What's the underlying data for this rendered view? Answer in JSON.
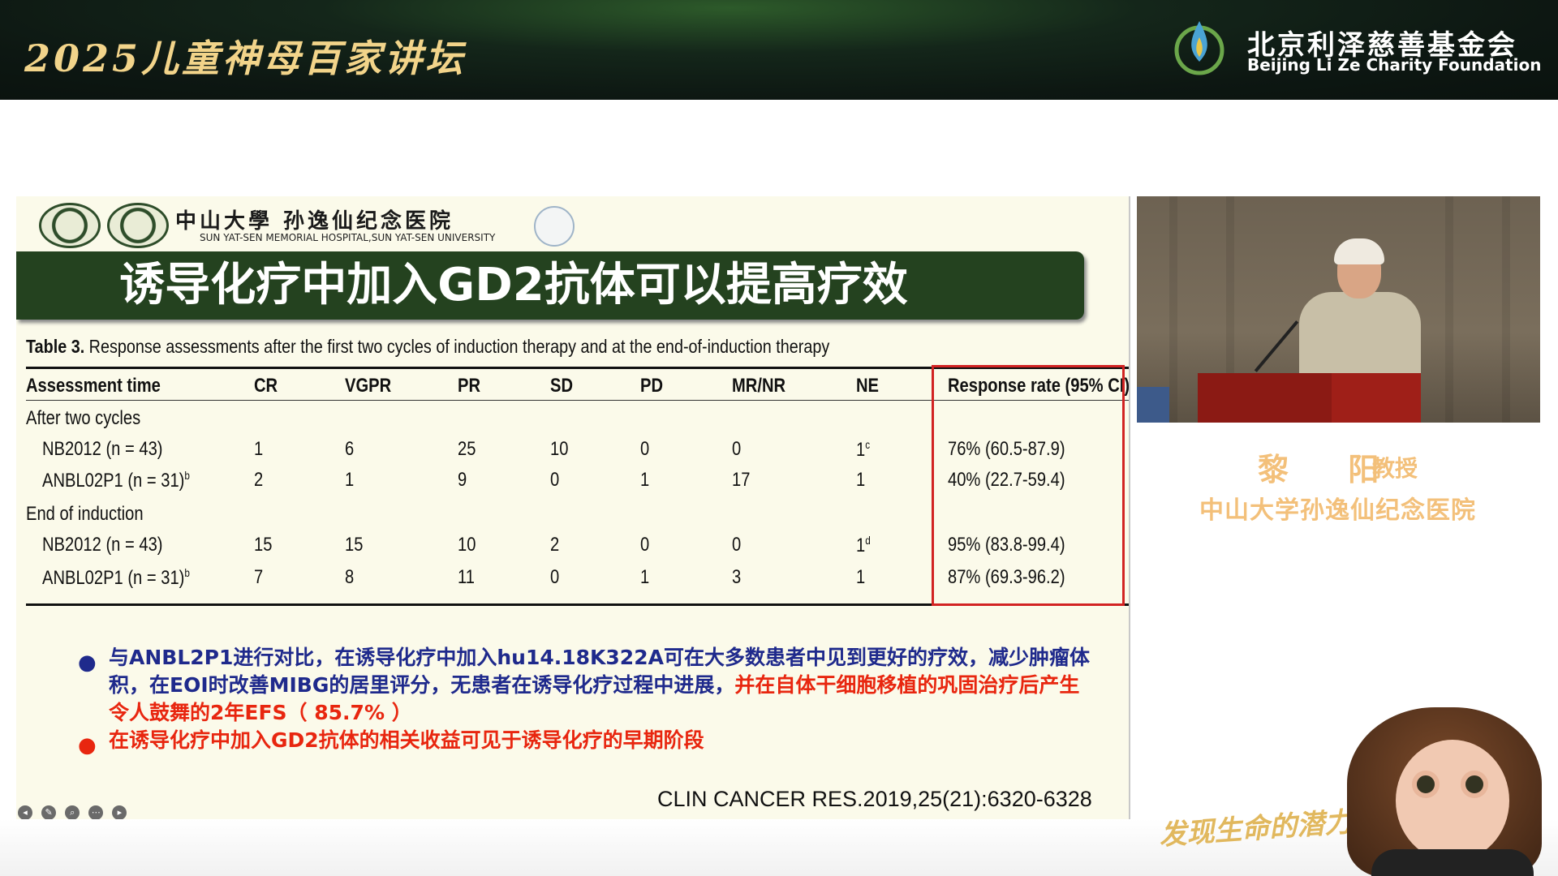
{
  "banner": {
    "event_title": "2025儿童神母百家讲坛",
    "foundation_cn": "北京利泽慈善基金会",
    "foundation_en": "Beijing Li Ze Charity Foundation"
  },
  "slide": {
    "hospital_cn": "中山大學 孙逸仙纪念医院",
    "hospital_en": "SUN YAT-SEN MEMORIAL HOSPITAL,SUN YAT-SEN UNIVERSITY",
    "title": "诱导化疗中加入GD2抗体可以提高疗效",
    "table": {
      "caption_label": "Table 3.",
      "caption_text": "Response assessments after the first two cycles of induction therapy and at the end-of-induction therapy",
      "headers": [
        "Assessment time",
        "CR",
        "VGPR",
        "PR",
        "SD",
        "PD",
        "MR/NR",
        "NE",
        "Response rate (95% CI)"
      ],
      "groups": [
        {
          "label": "After two cycles",
          "rows": [
            {
              "name": "NB2012 (n = 43)",
              "cr": "1",
              "vgpr": "6",
              "pr": "25",
              "sd": "10",
              "pd": "0",
              "mrnr": "0",
              "ne": "1",
              "ne_sup": "c",
              "rate": "76% (60.5-87.9)"
            },
            {
              "name": "ANBL02P1 (n = 31)",
              "name_sup": "b",
              "cr": "2",
              "vgpr": "1",
              "pr": "9",
              "sd": "0",
              "pd": "1",
              "mrnr": "17",
              "ne": "1",
              "rate": "40% (22.7-59.4)"
            }
          ]
        },
        {
          "label": "End of induction",
          "rows": [
            {
              "name": "NB2012 (n = 43)",
              "cr": "15",
              "vgpr": "15",
              "pr": "10",
              "sd": "2",
              "pd": "0",
              "mrnr": "0",
              "ne": "1",
              "ne_sup": "d",
              "rate": "95% (83.8-99.4)"
            },
            {
              "name": "ANBL02P1 (n = 31)",
              "name_sup": "b",
              "cr": "7",
              "vgpr": "8",
              "pr": "11",
              "sd": "0",
              "pd": "1",
              "mrnr": "3",
              "ne": "1",
              "rate": "87% (69.3-96.2)"
            }
          ]
        }
      ]
    },
    "bullets": {
      "b1_blue": "与ANBL2P1进行对比，在诱导化疗中加入hu14.18K322A可在大多数患者中见到更好的疗效，减少肿瘤体积，在EOI时改善MIBG的居里评分，无患者在诱导化疗过程中进展，",
      "b1_red": "并在自体干细胞移植的巩固治疗后",
      "b1_tail": "产生令人鼓舞的2年EFS（ 85.7% ）",
      "b2_red": "在诱导化疗中加入GD2抗体的相关收益可见于诱导化疗的早期阶段"
    },
    "citation": "CLIN CANCER RES.2019,25(21):6320-6328"
  },
  "speaker": {
    "name": "黎 阳",
    "role": "教授",
    "org": "中山大学孙逸仙纪念医院"
  },
  "footer": {
    "slogan": "发现生命的潜力"
  },
  "colors": {
    "title_band": "#24421f",
    "bullet_blue": "#1f2a8c",
    "bullet_red": "#e8260f",
    "highlight_box": "#d22323",
    "speaker_text": "#f3c07a"
  }
}
